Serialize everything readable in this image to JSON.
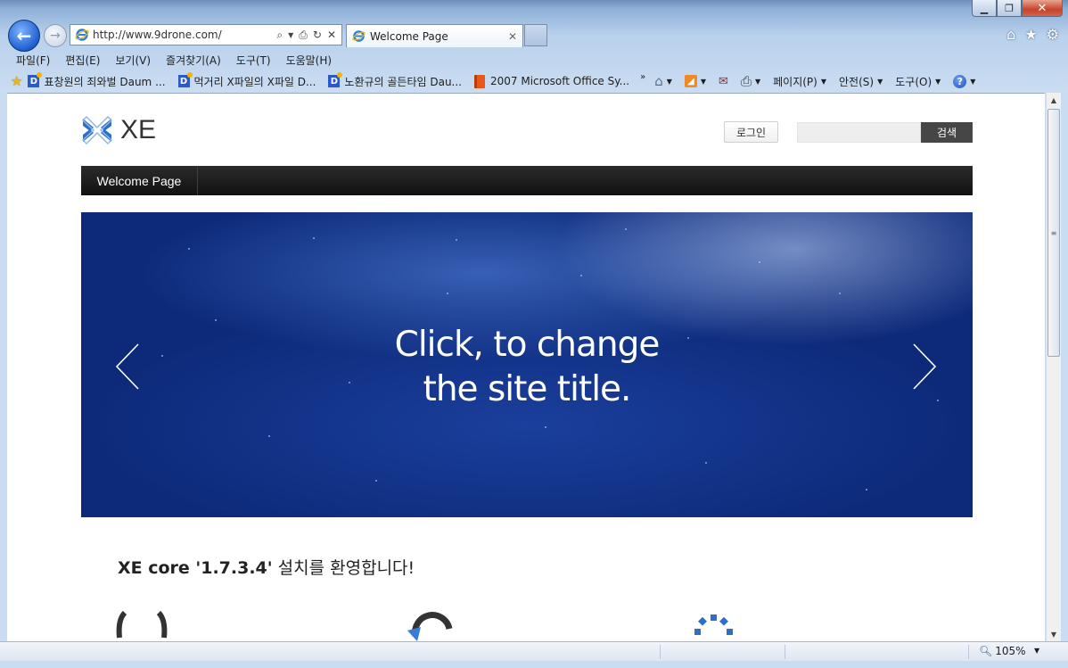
{
  "browser": {
    "address_url": "http://www.9drone.com/",
    "tab_title": "Welcome Page",
    "menu": [
      "파일(F)",
      "편집(E)",
      "보기(V)",
      "즐겨찾기(A)",
      "도구(T)",
      "도움말(H)"
    ],
    "favorites": [
      {
        "label": "표창원의 죄와벌  Daum ...",
        "icon": "daum-icon"
      },
      {
        "label": "먹거리 X파일의 X파일  D...",
        "icon": "daum-icon"
      },
      {
        "label": "노환규의 골든타임  Dau...",
        "icon": "daum-icon"
      },
      {
        "label": "2007 Microsoft Office Sy...",
        "icon": "office-icon"
      }
    ],
    "commands": {
      "page": "페이지(P)",
      "safety": "안전(S)",
      "tools": "도구(O)"
    },
    "zoom": "105%"
  },
  "site": {
    "logo_text": "XE",
    "login_label": "로그인",
    "search_label": "검색",
    "nav_items": [
      "Welcome Page"
    ],
    "hero_title": "Click, to change\nthe site title.",
    "welcome_prefix": "XE core '1.7.3.4'",
    "welcome_suffix": " 설치를 환영합니다!"
  }
}
